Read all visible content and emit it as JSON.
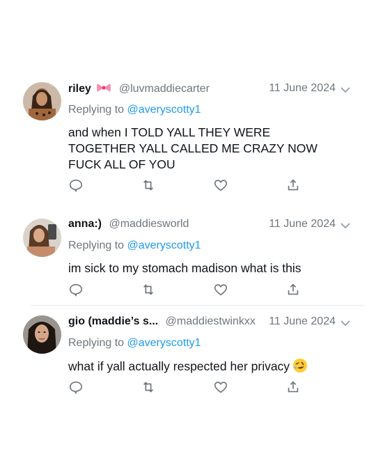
{
  "replying_prefix": "Replying to",
  "colors": {
    "text": "#0f1419",
    "secondary": "#6e767d",
    "link": "#1d9bf0",
    "divider": "#e6ecf0"
  },
  "icons": [
    "chevron-down-icon",
    "reply-icon",
    "retweet-icon",
    "like-icon",
    "share-icon",
    "bow-emoji",
    "rofl-emoji"
  ],
  "tweets": [
    {
      "name": "riley",
      "handle": "@luvmaddiecarter",
      "date": "11 June 2024",
      "reply_to": "@averyscotty1",
      "text_lines": [
        "and when I TOLD YALL THEY WERE",
        "TOGETHER YALL CALLED ME CRAZY NOW",
        "FUCK ALL OF YOU"
      ]
    },
    {
      "name": "anna:)",
      "handle": "@maddiesworld",
      "date": "11 June 2024",
      "reply_to": "@averyscotty1",
      "text_lines": [
        "im sick to my stomach madison what is this"
      ]
    },
    {
      "name": "gio (maddie’s s...",
      "handle": "@maddiestwinkxx",
      "date": "11 June 2024",
      "reply_to": "@averyscotty1",
      "text_lines": [
        "what if yall actually respected her privacy"
      ]
    }
  ]
}
